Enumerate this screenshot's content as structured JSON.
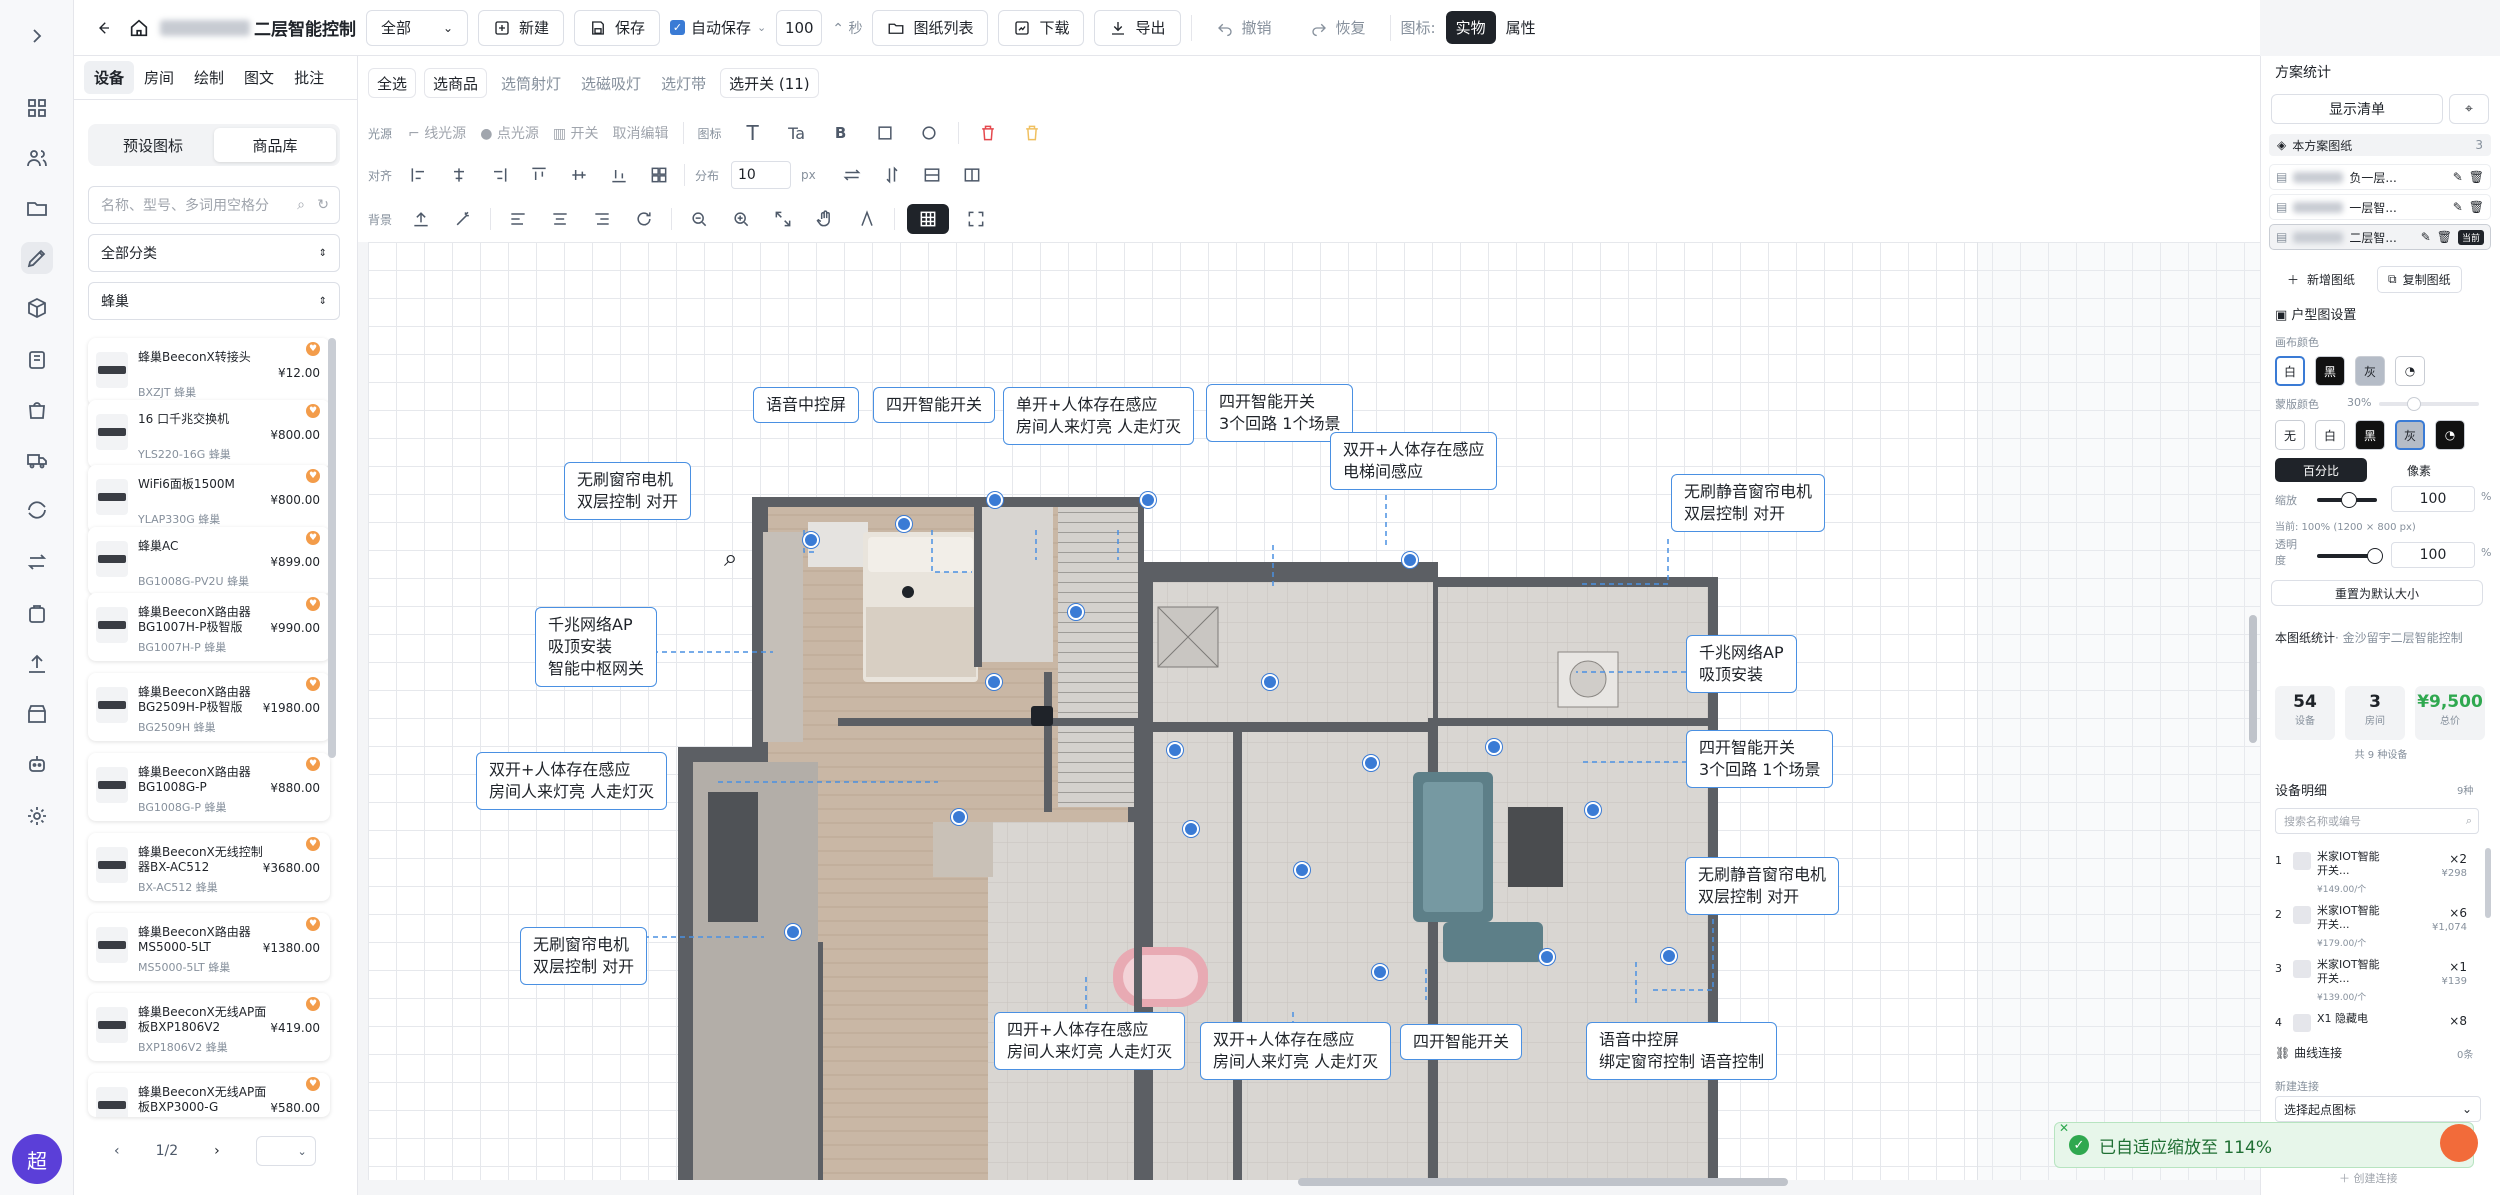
{
  "topbar": {
    "title": "二层智能控制",
    "scope": "全部",
    "new_label": "新建",
    "save_label": "保存",
    "autosave_label": "自动保存",
    "autosave_interval": "100",
    "autosave_unit": "秒",
    "drawings_label": "图纸列表",
    "download_label": "下载",
    "export_label": "导出",
    "undo_label": "撤销",
    "redo_label": "恢复",
    "icon_label": "图标:",
    "mode_real": "实物",
    "mode_attr": "属性"
  },
  "left_tabs": [
    "设备",
    "房间",
    "绘制",
    "图文",
    "批注"
  ],
  "left_panel": {
    "seg_preset": "预设图标",
    "seg_library": "商品库",
    "search_placeholder": "名称、型号、多词用空格分",
    "category": "全部分类",
    "brand": "蜂巢",
    "pager": "1/2",
    "products": [
      {
        "name": "蜂巢BeeconX转接头",
        "code": "BXZJT 蜂巢",
        "price": "¥12.00"
      },
      {
        "name": "16 口千兆交换机",
        "code": "YLS220-16G 蜂巢",
        "price": "¥800.00"
      },
      {
        "name": "WiFi6面板1500M",
        "code": "YLAP330G 蜂巢",
        "price": "¥800.00"
      },
      {
        "name": "蜂巢AC",
        "code": "BG1008G-PV2U 蜂巢",
        "price": "¥899.00"
      },
      {
        "name": "蜂巢BeeconX路由器BG1007H-P极智版",
        "code": "BG1007H-P 蜂巢",
        "price": "¥990.00"
      },
      {
        "name": "蜂巢BeeconX路由器BG2509H-P极智版",
        "code": "BG2509H 蜂巢",
        "price": "¥1980.00"
      },
      {
        "name": "蜂巢BeeconX路由器BG1008G-P",
        "code": "BG1008G-P 蜂巢",
        "price": "¥880.00"
      },
      {
        "name": "蜂巢BeeconX无线控制器BX-AC512",
        "code": "BX-AC512 蜂巢",
        "price": "¥3680.00"
      },
      {
        "name": "蜂巢BeeconX路由器MS5000-5LT",
        "code": "MS5000-5LT 蜂巢",
        "price": "¥1380.00"
      },
      {
        "name": "蜂巢BeeconX无线AP面板BXP1806V2",
        "code": "BXP1806V2 蜂巢",
        "price": "¥419.00"
      },
      {
        "name": "蜂巢BeeconX无线AP面板BXP3000-G",
        "code": "",
        "price": "¥580.00"
      }
    ]
  },
  "select_row": [
    "全选",
    "选商品",
    "选筒射灯",
    "选磁吸灯",
    "选灯带",
    "选开关 (11)"
  ],
  "tool_rows": {
    "r1_label": "光源",
    "r1_items": [
      "线光源",
      "点光源",
      "开关",
      "取消编辑"
    ],
    "r1_icon_label": "图标",
    "r1_text_t": "T",
    "r1_text_ta": "Ta",
    "r1_text_b": "B",
    "r2_label": "对齐",
    "r2_dist_label": "分布",
    "r2_dist_value": "10",
    "r2_unit": "px",
    "r3_label": "背景"
  },
  "callouts": [
    {
      "id": "c1",
      "lines": [
        "语音中控屏"
      ]
    },
    {
      "id": "c2",
      "lines": [
        "四开智能开关"
      ]
    },
    {
      "id": "c3",
      "lines": [
        "单开+人体存在感应",
        "房间人来灯亮 人走灯灭"
      ]
    },
    {
      "id": "c4",
      "lines": [
        "四开智能开关",
        "3个回路 1个场景"
      ]
    },
    {
      "id": "c5",
      "lines": [
        "双开+人体存在感应",
        "电梯间感应"
      ]
    },
    {
      "id": "c6",
      "lines": [
        "无刷窗帘电机",
        "双层控制 对开"
      ]
    },
    {
      "id": "c7",
      "lines": [
        "无刷静音窗帘电机",
        "双层控制 对开"
      ]
    },
    {
      "id": "c8",
      "lines": [
        "千兆网络AP",
        "吸顶安装",
        "智能中枢网关"
      ]
    },
    {
      "id": "c9",
      "lines": [
        "千兆网络AP",
        "吸顶安装"
      ]
    },
    {
      "id": "c10",
      "lines": [
        "双开+人体存在感应",
        "房间人来灯亮 人走灯灭"
      ]
    },
    {
      "id": "c11",
      "lines": [
        "四开智能开关",
        "3个回路 1个场景"
      ]
    },
    {
      "id": "c12",
      "lines": [
        "无刷静音窗帘电机",
        "双层控制 对开"
      ]
    },
    {
      "id": "c13",
      "lines": [
        "无刷窗帘电机",
        "双层控制 对开"
      ]
    },
    {
      "id": "c14",
      "lines": [
        "四开+人体存在感应",
        "房间人来灯亮 人走灯灭"
      ]
    },
    {
      "id": "c15",
      "lines": [
        "双开+人体存在感应",
        "房间人来灯亮 人走灯灭"
      ]
    },
    {
      "id": "c16",
      "lines": [
        "四开智能开关"
      ]
    },
    {
      "id": "c17",
      "lines": [
        "语音中控屏",
        "绑定窗帘控制 语音控制"
      ]
    }
  ],
  "right_panel": {
    "title": "方案统计",
    "show_list": "显示清单",
    "plan_sheets": "本方案图纸",
    "sheet_count": "3",
    "sheets": [
      "负一层...",
      "一层智...",
      "二层智..."
    ],
    "current_tag": "当前",
    "add_sheet": "新增图纸",
    "copy_sheet": "复制图纸",
    "layout_settings": "户型图设置",
    "canvas_color": "画布颜色",
    "canvas_swatches": [
      "白",
      "黑",
      "灰"
    ],
    "mask_color": "蒙版颜色",
    "mask_opacity": "30%",
    "mask_swatches": [
      "无",
      "白",
      "黑",
      "灰"
    ],
    "mode_percent": "百分比",
    "mode_pixel": "像素",
    "scale_label": "缩放",
    "scale_value": "100",
    "pct": "%",
    "current_size": "当前: 100% (1200 × 800 px)",
    "opacity_label": "透明度",
    "opacity_value": "100",
    "reset_size": "重置为默认大小",
    "sheet_stats": "本图纸统计",
    "sheet_stats_sub": "· 金沙留宇二层智能控制",
    "stat_devices": "54",
    "stat_devices_label": "设备",
    "stat_rooms": "3",
    "stat_rooms_label": "房间",
    "stat_total": "¥9,500",
    "stat_total_label": "总价",
    "stat_kinds": "共 9 种设备",
    "device_detail": "设备明细",
    "device_detail_count": "9种",
    "device_search": "搜索名称或编号",
    "devices": [
      {
        "idx": "1",
        "name": "米家IOT智能开关...",
        "qty": "×2",
        "sum": "¥298",
        "unit": "¥149.00/个"
      },
      {
        "idx": "2",
        "name": "米家IOT智能开关...",
        "qty": "×6",
        "sum": "¥1,074",
        "unit": "¥179.00/个"
      },
      {
        "idx": "3",
        "name": "米家IOT智能开关...",
        "qty": "×1",
        "sum": "¥139",
        "unit": "¥139.00/个"
      },
      {
        "idx": "4",
        "name": "X1 隐藏电",
        "qty": "×8",
        "sum": "",
        "unit": ""
      }
    ],
    "curve_link": "曲线连接",
    "curve_count": "0条",
    "new_link": "新建连接",
    "pick_start": "选择起点图标",
    "create_link": "创建连接"
  },
  "toast": "已自适应缩放至 114%",
  "colors": {
    "accent": "#3a7bd5",
    "brand": "#5b3fd8",
    "success": "#2fa84f",
    "danger": "#e5484d"
  }
}
